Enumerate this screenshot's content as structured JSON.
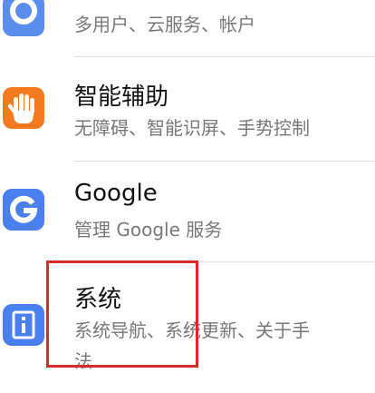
{
  "settings_list": {
    "items": [
      {
        "id": "accounts",
        "title": "",
        "subtitle": "多用户、云服务、帐户",
        "icon": "account-icon",
        "icon_color": "#5b8def"
      },
      {
        "id": "smart-assist",
        "title": "智能辅助",
        "subtitle": "无障碍、智能识屏、手势控制",
        "icon": "hand-icon",
        "icon_color": "#f57a1f"
      },
      {
        "id": "google",
        "title": "Google",
        "subtitle": "管理 Google 服务",
        "icon": "google-g-icon",
        "icon_color": "#4a7ff0"
      },
      {
        "id": "system",
        "title": "系统",
        "subtitle_line1": "系统导航、系统更新、关于手",
        "subtitle_line2": "法",
        "icon": "system-info-icon",
        "icon_color": "#4a7ff0"
      }
    ]
  },
  "highlight": {
    "color": "#d72a2a",
    "target": "system"
  }
}
